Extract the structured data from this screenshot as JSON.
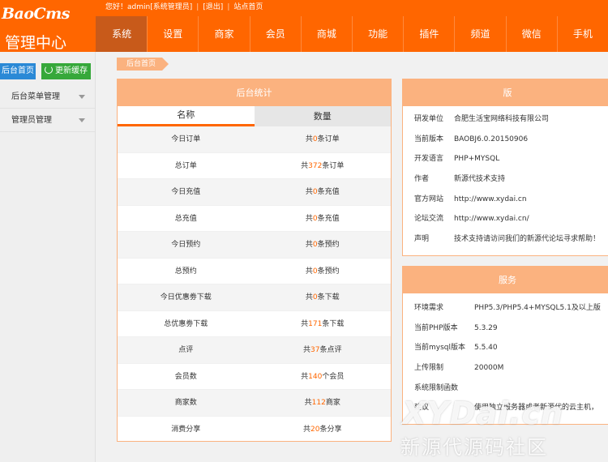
{
  "brand": {
    "logo": "BaoCms",
    "subtitle": "管理中心"
  },
  "topbar": {
    "greeting": "您好！admin[系统管理员]",
    "logout": "[退出]",
    "site_home": "站点首页"
  },
  "nav": [
    "系统",
    "设置",
    "商家",
    "会员",
    "商城",
    "功能",
    "插件",
    "频道",
    "微信",
    "手机"
  ],
  "sidebar": {
    "home_button": "后台首页",
    "cache_button": "更新缓存",
    "items": [
      {
        "label": "后台菜单管理"
      },
      {
        "label": "管理员管理"
      }
    ]
  },
  "breadcrumb": "后台首页",
  "stats": {
    "title": "后台统计",
    "col_name": "名称",
    "col_count": "数量",
    "rows": [
      {
        "name": "今日订单",
        "pre": "共",
        "num": "0",
        "post": "条订单"
      },
      {
        "name": "总订单",
        "pre": "共",
        "num": "372",
        "post": "条订单"
      },
      {
        "name": "今日充值",
        "pre": "共",
        "num": "0",
        "post": "条充值"
      },
      {
        "name": "总充值",
        "pre": "共",
        "num": "0",
        "post": "条充值"
      },
      {
        "name": "今日预约",
        "pre": "共",
        "num": "0",
        "post": "条预约"
      },
      {
        "name": "总预约",
        "pre": "共",
        "num": "0",
        "post": "条预约"
      },
      {
        "name": "今日优惠劵下载",
        "pre": "共",
        "num": "0",
        "post": "条下载"
      },
      {
        "name": "总优惠劵下载",
        "pre": "共",
        "num": "171",
        "post": "条下载"
      },
      {
        "name": "点评",
        "pre": "共",
        "num": "37",
        "post": "条点评"
      },
      {
        "name": "会员数",
        "pre": "共",
        "num": "140",
        "post": "个会员"
      },
      {
        "name": "商家数",
        "pre": "共",
        "num": "112",
        "post": "商家"
      },
      {
        "name": "消费分享",
        "pre": "共",
        "num": "20",
        "post": "条分享"
      }
    ]
  },
  "info_panel": {
    "title": "版",
    "rows": [
      {
        "k": "研发单位",
        "v": "合肥生活宝网络科技有限公司"
      },
      {
        "k": "当前版本",
        "v": "BAOBJ6.0.20150906"
      },
      {
        "k": "开发语言",
        "v": "PHP+MYSQL"
      },
      {
        "k": "作者",
        "v": "新源代技术支持"
      },
      {
        "k": "官方网站",
        "v": "http://www.xydai.cn"
      },
      {
        "k": "论坛交流",
        "v": "http://www.xydai.cn/"
      },
      {
        "k": "声明",
        "v": "技术支持请访问我们的新源代论坛寻求帮助！"
      }
    ]
  },
  "server_panel": {
    "title": "服务",
    "rows": [
      {
        "k": "环境需求",
        "v": "PHP5.3/PHP5.4+MYSQL5.1及以上版"
      },
      {
        "k": "当前PHP版本",
        "v": "5.3.29"
      },
      {
        "k": "当前mysql版本",
        "v": "5.5.40"
      },
      {
        "k": "上传限制",
        "v": "20000M"
      },
      {
        "k": "系统限制函数",
        "v": ""
      },
      {
        "k": "建议",
        "v": "使用独立服务器或者新源代的云主机，"
      }
    ]
  },
  "watermark": {
    "line1": "XYDai.cn",
    "line2": "新源代源码社区"
  }
}
